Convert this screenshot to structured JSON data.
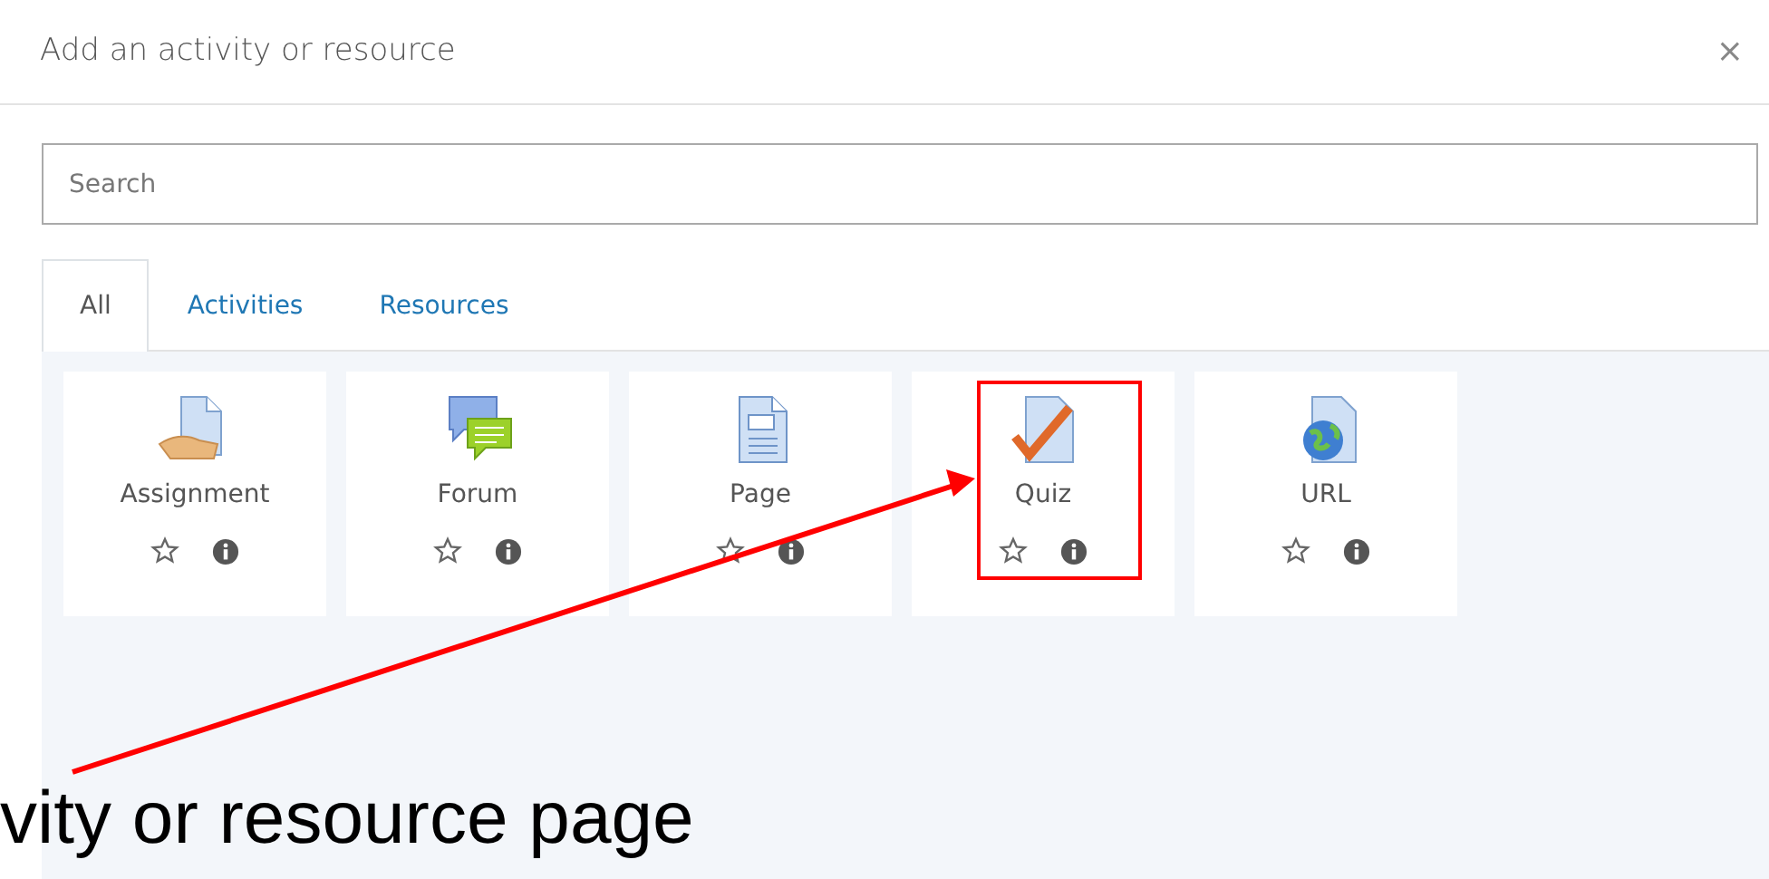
{
  "dialog": {
    "title": "Add an activity or resource",
    "close": "×"
  },
  "search": {
    "placeholder": "Search"
  },
  "tabs": [
    {
      "label": "All",
      "selected": true
    },
    {
      "label": "Activities",
      "selected": false
    },
    {
      "label": "Resources",
      "selected": false
    }
  ],
  "items": [
    {
      "name": "Assignment",
      "kind": "assignment",
      "highlighted": false
    },
    {
      "name": "Forum",
      "kind": "forum",
      "highlighted": false
    },
    {
      "name": "Page",
      "kind": "page",
      "highlighted": false
    },
    {
      "name": "Quiz",
      "kind": "quiz",
      "highlighted": true
    },
    {
      "name": "URL",
      "kind": "url",
      "highlighted": false
    }
  ],
  "callout": {
    "text": "vity or resource page"
  }
}
